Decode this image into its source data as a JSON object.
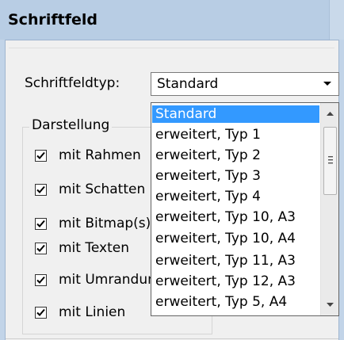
{
  "window": {
    "title": "Schriftfeld"
  },
  "form": {
    "type_label": "Schriftfeldtyp:",
    "type_value": "Standard"
  },
  "group": {
    "legend": "Darstellung",
    "checkboxes": [
      {
        "label": "mit Rahmen",
        "checked": true
      },
      {
        "label": "mit Schatten",
        "checked": true
      },
      {
        "label": "mit Bitmap(s)",
        "checked": true
      },
      {
        "label": "mit Texten",
        "checked": true
      },
      {
        "label": "mit Umrandung",
        "checked": true
      },
      {
        "label": "mit Linien",
        "checked": true
      }
    ]
  },
  "dropdown": {
    "selected_index": 0,
    "items": [
      "Standard",
      "erweitert, Typ 1",
      "erweitert, Typ 2",
      "erweitert, Typ 3",
      "erweitert, Typ 4",
      "erweitert, Typ 10, A3",
      "erweitert, Typ 10, A4",
      "erweitert, Typ 11, A3",
      "erweitert, Typ 12, A3",
      "erweitert, Typ 5, A4"
    ]
  },
  "colors": {
    "selection": "#3399ff",
    "titlebar": "#b8cde4"
  }
}
